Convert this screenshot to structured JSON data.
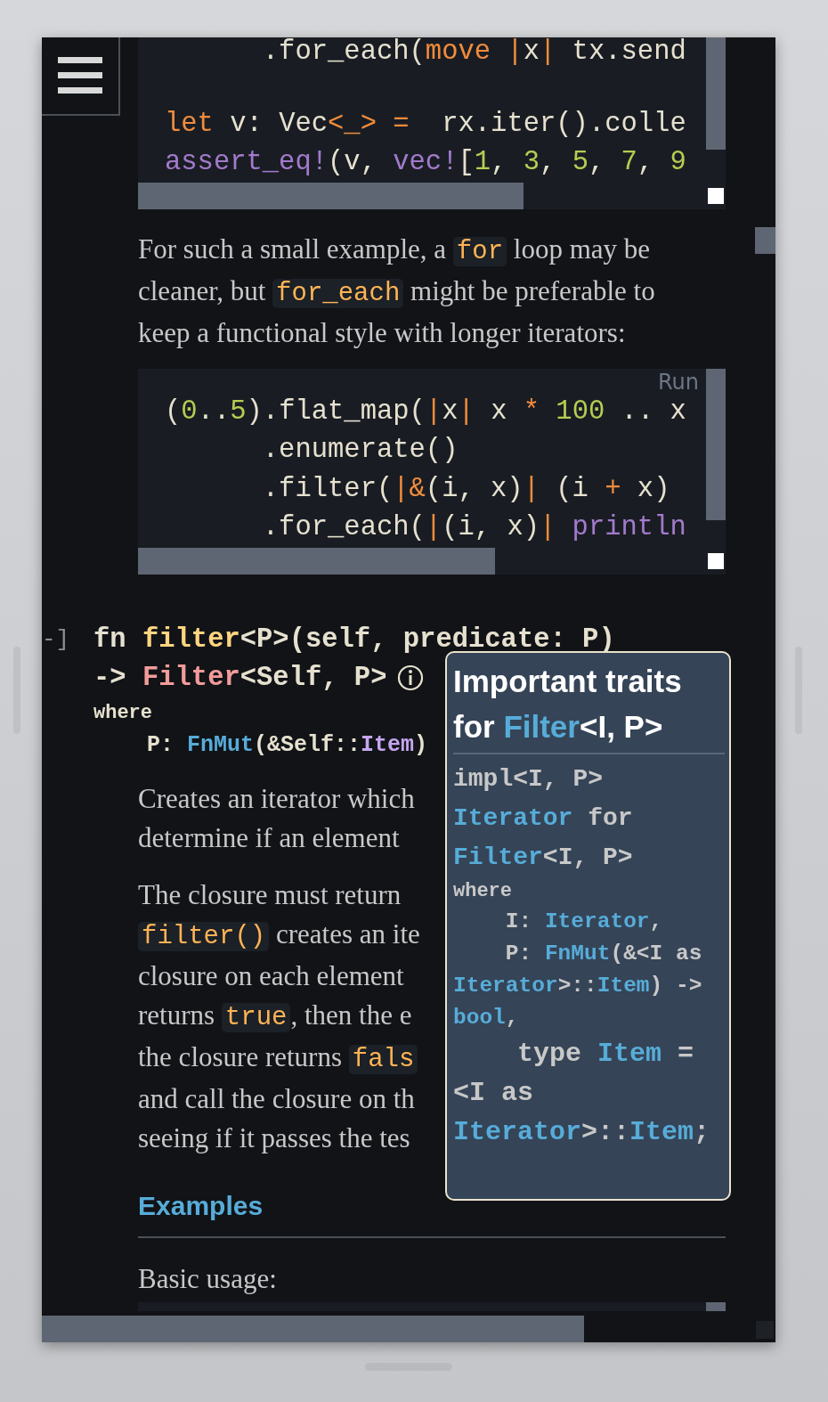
{
  "blocks": [
    {
      "kind": "code",
      "lines": [
        {
          "tokens": [
            {
              "kind": "p",
              "text": "      .for_each("
            },
            {
              "kind": "kw",
              "text": "move |"
            },
            {
              "kind": "p",
              "text": "x"
            },
            {
              "kind": "kw",
              "text": "|"
            },
            {
              "kind": "p",
              "text": " tx.send"
            }
          ]
        },
        {
          "gap": true,
          "tokens": [
            {
              "kind": "kw",
              "text": "let"
            },
            {
              "kind": "p",
              "text": " v: Vec"
            },
            {
              "kind": "kw",
              "text": "<_> ="
            },
            {
              "kind": "p",
              "text": "  rx.iter().colle"
            }
          ]
        },
        {
          "tokens": [
            {
              "kind": "mac",
              "text": "assert_eq!"
            },
            {
              "kind": "p",
              "text": "(v, "
            },
            {
              "kind": "mac",
              "text": "vec!"
            },
            {
              "kind": "p",
              "text": "["
            },
            {
              "kind": "num",
              "text": "1"
            },
            {
              "kind": "p",
              "text": ", "
            },
            {
              "kind": "num",
              "text": "3"
            },
            {
              "kind": "p",
              "text": ", "
            },
            {
              "kind": "num",
              "text": "5"
            },
            {
              "kind": "p",
              "text": ", "
            },
            {
              "kind": "num",
              "text": "7"
            },
            {
              "kind": "p",
              "text": ", "
            },
            {
              "kind": "num",
              "text": "9"
            }
          ]
        }
      ]
    },
    {
      "kind": "paragraph",
      "lines": [
        [
          {
            "text": "For such a small example, a "
          },
          {
            "text": "for",
            "code": true
          },
          {
            "text": " loop may be"
          }
        ],
        [
          {
            "text": "cleaner, but "
          },
          {
            "text": "for_each",
            "code": true
          },
          {
            "text": " might be preferable to"
          }
        ],
        [
          {
            "text": "keep a functional style with longer iterators:"
          }
        ]
      ]
    },
    {
      "kind": "code",
      "run": "Run",
      "lines": [
        {
          "tokens": [
            {
              "kind": "p",
              "text": "("
            },
            {
              "kind": "num",
              "text": "0"
            },
            {
              "kind": "p",
              "text": ".."
            },
            {
              "kind": "num",
              "text": "5"
            },
            {
              "kind": "p",
              "text": ").flat_map("
            },
            {
              "kind": "kw",
              "text": "|"
            },
            {
              "kind": "p",
              "text": "x"
            },
            {
              "kind": "kw",
              "text": "|"
            },
            {
              "kind": "p",
              "text": " x "
            },
            {
              "kind": "kw",
              "text": "*"
            },
            {
              "kind": "num",
              "text": " 100"
            },
            {
              "kind": "p",
              "text": " .. x"
            }
          ]
        },
        {
          "tokens": [
            {
              "kind": "p",
              "text": "      .enumerate()"
            }
          ]
        },
        {
          "tokens": [
            {
              "kind": "p",
              "text": "      .filter("
            },
            {
              "kind": "kw",
              "text": "|&"
            },
            {
              "kind": "p",
              "text": "(i, x)"
            },
            {
              "kind": "kw",
              "text": "|"
            },
            {
              "kind": "p",
              "text": " (i "
            },
            {
              "kind": "kw",
              "text": "+"
            },
            {
              "kind": "p",
              "text": " x)"
            }
          ]
        },
        {
          "tokens": [
            {
              "kind": "p",
              "text": "      .for_each("
            },
            {
              "kind": "kw",
              "text": "|"
            },
            {
              "kind": "p",
              "text": "(i, x)"
            },
            {
              "kind": "kw",
              "text": "|"
            },
            {
              "kind": "mac",
              "text": " println"
            }
          ]
        }
      ]
    },
    {
      "kind": "signature",
      "toggle": "-]",
      "lines": [
        {
          "kind": "main",
          "tokens": [
            {
              "kind": "p",
              "text": "fn "
            },
            {
              "kind": "fn",
              "text": "filter"
            },
            {
              "kind": "p",
              "text": "<P>(self, predicate: P)"
            }
          ]
        },
        {
          "kind": "ret",
          "tokens": [
            {
              "kind": "p",
              "text": "-> "
            },
            {
              "kind": "type",
              "text": "Filter"
            },
            {
              "kind": "p",
              "text": "<Self, P>"
            }
          ]
        },
        {
          "kind": "where",
          "tokens": [
            {
              "kind": "p",
              "text": "where"
            }
          ]
        },
        {
          "kind": "bound",
          "tokens": [
            {
              "kind": "p",
              "text": "    P: "
            },
            {
              "kind": "trait",
              "text": "FnMut"
            },
            {
              "kind": "p",
              "text": "(&Self::"
            },
            {
              "kind": "assoc",
              "text": "Item"
            },
            {
              "kind": "p",
              "text": ")"
            }
          ]
        }
      ]
    },
    {
      "kind": "paragraph",
      "lines": [
        [
          {
            "text": "Creates an iterator which"
          }
        ],
        [
          {
            "text": "determine if an element"
          }
        ]
      ]
    },
    {
      "kind": "paragraph",
      "lines": [
        [
          {
            "text": "The closure must return"
          }
        ],
        [
          {
            "text": "filter()",
            "code": true
          },
          {
            "text": " creates an ite"
          }
        ],
        [
          {
            "text": "closure on each element"
          }
        ],
        [
          {
            "text": "returns "
          },
          {
            "text": "true",
            "code": true
          },
          {
            "text": ", then the e"
          }
        ],
        [
          {
            "text": "the closure returns "
          },
          {
            "text": "fals",
            "code": true
          }
        ],
        [
          {
            "text": "and call the closure on th"
          }
        ],
        [
          {
            "text": "seeing if it passes the tes"
          }
        ]
      ]
    },
    {
      "kind": "heading",
      "text": "Examples"
    },
    {
      "kind": "paragraph",
      "lines": [
        [
          {
            "text": "Basic usage:"
          }
        ]
      ]
    }
  ],
  "tooltip": {
    "title": [
      {
        "text": "Important traits for "
      },
      {
        "text": "Filter",
        "kind": "trait"
      },
      {
        "text": "<I, P>"
      }
    ],
    "lines": [
      {
        "kind": "main",
        "tokens": [
          {
            "kind": "p",
            "text": "impl<I, P>"
          }
        ]
      },
      {
        "kind": "main",
        "tokens": [
          {
            "kind": "trait",
            "text": "Iterator"
          },
          {
            "kind": "p",
            "text": " for"
          }
        ]
      },
      {
        "kind": "main",
        "tokens": [
          {
            "kind": "trait",
            "text": "Filter"
          },
          {
            "kind": "p",
            "text": "<I, P>"
          }
        ]
      },
      {
        "kind": "where",
        "tokens": [
          {
            "kind": "p",
            "text": "where"
          }
        ]
      },
      {
        "kind": "bound",
        "tokens": [
          {
            "kind": "p",
            "text": "    I: "
          },
          {
            "kind": "trait",
            "text": "Iterator"
          },
          {
            "kind": "p",
            "text": ","
          }
        ]
      },
      {
        "kind": "bound",
        "tokens": [
          {
            "kind": "p",
            "text": "    P: "
          },
          {
            "kind": "trait",
            "text": "FnMut"
          },
          {
            "kind": "p",
            "text": "(&<I as"
          }
        ]
      },
      {
        "kind": "bound",
        "tokens": [
          {
            "kind": "trait",
            "text": "Iterator"
          },
          {
            "kind": "p",
            "text": ">::"
          },
          {
            "kind": "trait",
            "text": "Item"
          },
          {
            "kind": "p",
            "text": ") ->"
          }
        ]
      },
      {
        "kind": "bound",
        "tokens": [
          {
            "kind": "trait",
            "text": "bool"
          },
          {
            "kind": "p",
            "text": ","
          }
        ]
      },
      {
        "kind": "assoc",
        "tokens": [
          {
            "kind": "p",
            "text": "    type "
          },
          {
            "kind": "trait",
            "text": "Item"
          },
          {
            "kind": "p",
            "text": " ="
          }
        ]
      },
      {
        "kind": "assoc",
        "tokens": [
          {
            "kind": "p",
            "text": "<I as"
          }
        ]
      },
      {
        "kind": "assoc",
        "tokens": [
          {
            "kind": "trait",
            "text": "Iterator"
          },
          {
            "kind": "p",
            "text": ">::"
          },
          {
            "kind": "trait",
            "text": "Item"
          },
          {
            "kind": "p",
            "text": ";"
          }
        ]
      }
    ]
  }
}
